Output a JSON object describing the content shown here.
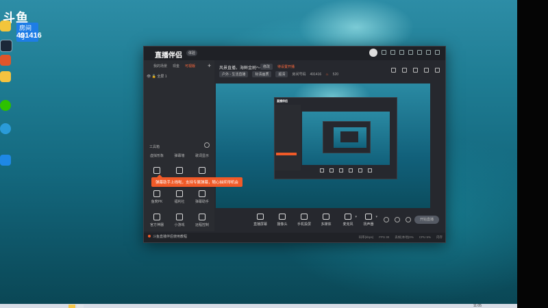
{
  "desktop": {
    "logo_brand": "斗鱼",
    "logo_badge": "房间号",
    "room_number": "491416",
    "icons": [
      {
        "label": "",
        "icon": "qq-icon",
        "color": "#f3c53b"
      },
      {
        "label": "",
        "icon": "steam-icon",
        "color": "#1b2838"
      },
      {
        "label": "",
        "icon": "app-icon",
        "color": "#e0552a"
      },
      {
        "label": "",
        "icon": "game-icon",
        "color": "#f4c23f"
      },
      {
        "label": "",
        "icon": "wechat-icon",
        "color": "#2dc100"
      },
      {
        "label": "",
        "icon": "edge-icon",
        "color": "#2a9bd8"
      },
      {
        "label": "",
        "icon": "browser-icon",
        "color": "#1e88e5"
      }
    ]
  },
  "app": {
    "title": "直播伴侣",
    "version_badge": "体验",
    "sidebar": {
      "tabs": [
        "我的场景",
        "现金",
        "可视版"
      ],
      "active_tab": 2,
      "add_label": "+",
      "scene_label": "全屏 1",
      "tools_title": "工具箱",
      "tools": [
        {
          "label": "虚拟形象",
          "icon": "avatar-icon"
        },
        {
          "label": "弹幕墙",
          "icon": "barrage-icon"
        },
        {
          "label": "歌词显示",
          "icon": "lyrics-icon"
        },
        {
          "label": "",
          "icon": "plugin-icon"
        },
        {
          "label": "",
          "icon": "download-icon"
        },
        {
          "label": "",
          "icon": "mic-icon"
        },
        {
          "label": "鱼窝PK",
          "icon": "home-icon"
        },
        {
          "label": "福利社",
          "icon": "gift-icon"
        },
        {
          "label": "弹幕助手",
          "icon": "assist-icon"
        },
        {
          "label": "官方神器",
          "icon": "tool-icon"
        },
        {
          "label": "小游戏",
          "icon": "gamepad-icon"
        },
        {
          "label": "远程控制",
          "icon": "remote-icon"
        }
      ],
      "tooltip": "弹幕助手上线啦，支持专属弹幕，随心抽奖得机会",
      "notice": "斗鱼直播伴侣使用教程"
    },
    "header": {
      "room_title": "风景直播，海鲜金刷～",
      "edit_badge": "修改",
      "status_tag": "待设置开播",
      "category": "户外 - 生活直播",
      "quality": "标清画质",
      "quality_tag": "超清",
      "room_id_label": "房间号码",
      "room_id": "491416",
      "heat": "520"
    },
    "controls": [
      {
        "label": "直播屏幕",
        "icon": "screen-icon"
      },
      {
        "label": "摄像头",
        "icon": "camera-icon"
      },
      {
        "label": "手机投屏",
        "icon": "phone-cast-icon"
      },
      {
        "label": "多媒体",
        "icon": "media-icon"
      },
      {
        "label": "麦克风",
        "icon": "mic-icon"
      },
      {
        "label": "扬声器",
        "icon": "speaker-icon"
      }
    ],
    "go_live": "开始直播",
    "stats": [
      "码率(kbps)",
      "FPS 30",
      "丢帧(本地)0%",
      "CPU 5%",
      "内存"
    ]
  },
  "taskbar": {
    "clock": "11:05"
  }
}
